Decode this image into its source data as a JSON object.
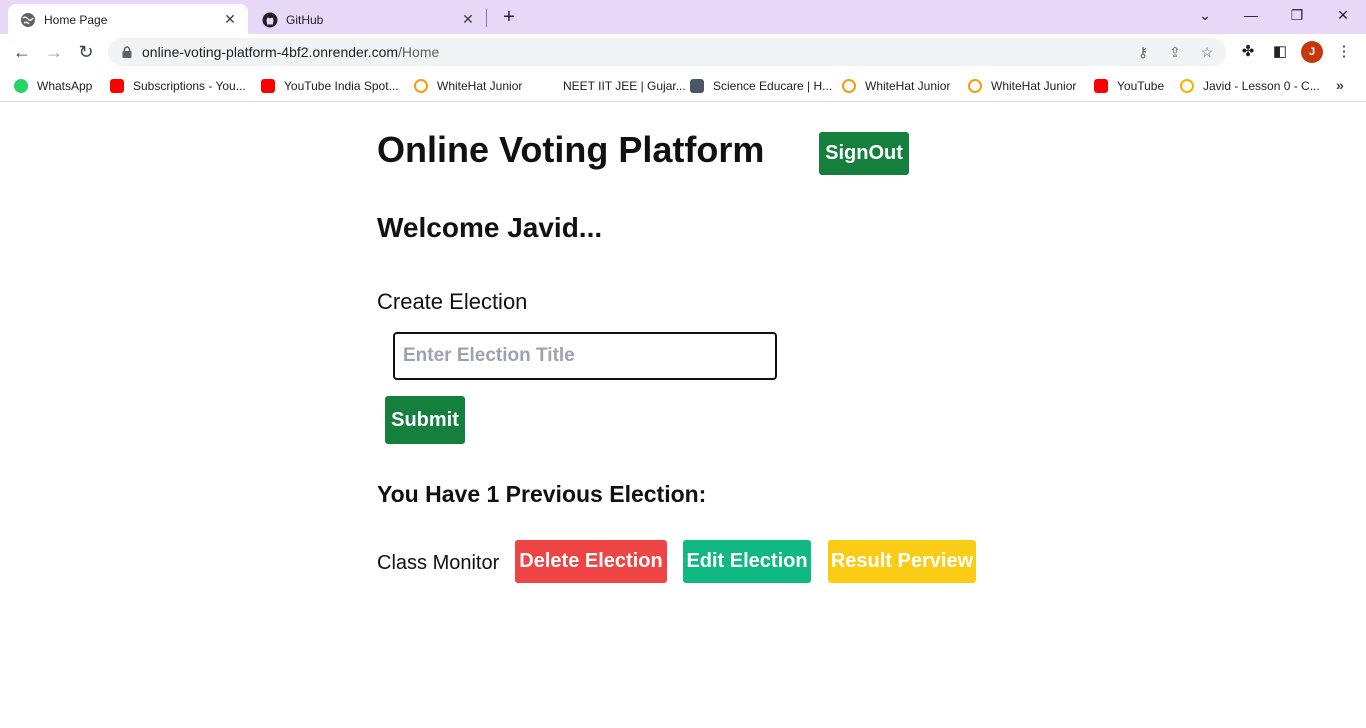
{
  "browser": {
    "tabs": [
      {
        "title": "Home Page",
        "icon": "globe-icon",
        "active": true
      },
      {
        "title": "GitHub",
        "icon": "github-icon",
        "active": false
      }
    ],
    "url_host": "online-voting-platform-4bf2.onrender.com",
    "url_path": "/Home",
    "profile_initial": "J",
    "bookmarks": [
      {
        "label": "WhatsApp",
        "icon": "whatsapp-icon",
        "color": "#25d366"
      },
      {
        "label": "Subscriptions - You...",
        "icon": "youtube-icon",
        "color": "#ff0000"
      },
      {
        "label": "YouTube India Spot...",
        "icon": "youtube-icon",
        "color": "#ff0000"
      },
      {
        "label": "WhiteHat Junior",
        "icon": "whitehat-icon",
        "color": "#f59e0b"
      },
      {
        "label": "NEET IIT JEE | Gujar...",
        "icon": "blank-icon",
        "color": "#ffffff"
      },
      {
        "label": "Science Educare | H...",
        "icon": "science-icon",
        "color": "#4b5563"
      },
      {
        "label": "WhiteHat Junior",
        "icon": "whitehat-icon",
        "color": "#f59e0b"
      },
      {
        "label": "WhiteHat Junior",
        "icon": "whitehat-icon",
        "color": "#f59e0b"
      },
      {
        "label": "YouTube",
        "icon": "youtube-icon",
        "color": "#ff0000"
      },
      {
        "label": "Javid - Lesson 0 - C...",
        "icon": "codingal-icon",
        "color": "#f5b301"
      }
    ]
  },
  "page": {
    "title": "Online Voting Platform",
    "signout_label": "SignOut",
    "welcome": "Welcome Javid...",
    "create_label": "Create Election",
    "title_placeholder": "Enter Election Title",
    "submit_label": "Submit",
    "previous_heading": "You Have 1 Previous Election:",
    "elections": [
      {
        "name": "Class Monitor",
        "delete_label": "Delete Election",
        "edit_label": "Edit Election",
        "result_label": "Result Perview"
      }
    ]
  },
  "colors": {
    "tabstrip": "#e7d8f8",
    "green": "#15803d",
    "red": "#ef4444",
    "teal": "#10b981",
    "yellow": "#facc15"
  }
}
